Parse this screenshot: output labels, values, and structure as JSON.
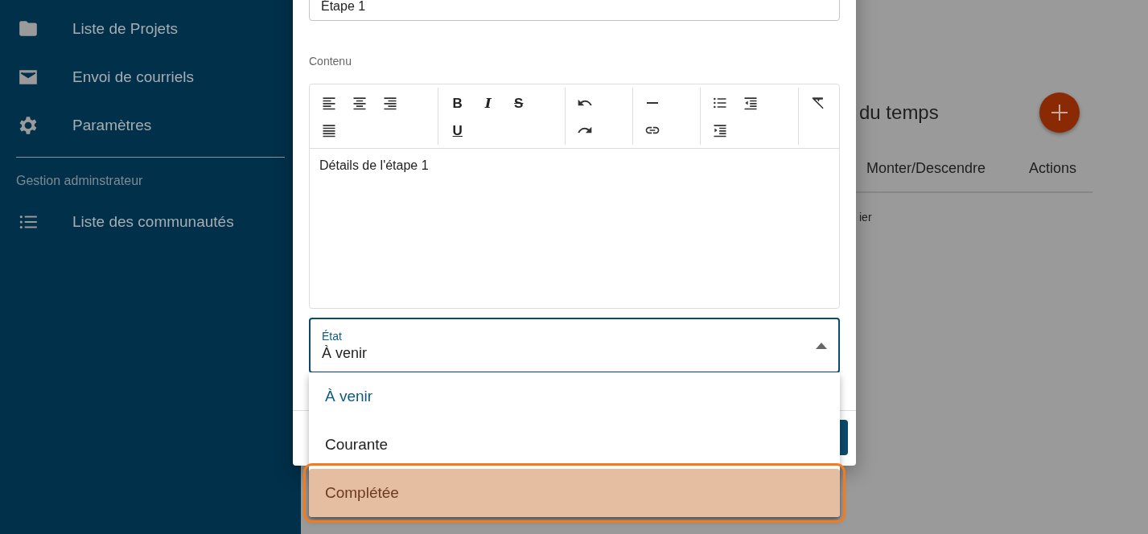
{
  "sidebar": {
    "items": [
      {
        "kind": "folder",
        "label": "Liste de Projets"
      },
      {
        "kind": "mail",
        "label": "Envoi de courriels"
      },
      {
        "kind": "settings",
        "label": "Paramètres"
      }
    ],
    "section_label": "Gestion adminstrateur",
    "admin_items": [
      {
        "kind": "list",
        "label": "Liste des communautés"
      }
    ]
  },
  "background_page": {
    "title": "du temps",
    "columns": [
      "Monter/Descendre",
      "Actions"
    ],
    "cell": "ier"
  },
  "dialog": {
    "name_field": {
      "value": "Étape 1"
    },
    "content_label": "Contenu",
    "editor": {
      "toolbar": [
        [
          {
            "kind": "align-left"
          },
          {
            "kind": "align-center"
          },
          {
            "kind": "align-right"
          },
          {
            "kind": "justify"
          }
        ],
        [
          {
            "kind": "bold",
            "label": "B"
          },
          {
            "kind": "italic",
            "label": "I"
          },
          {
            "kind": "strike",
            "label": "S"
          },
          {
            "kind": "underline",
            "label": "U"
          }
        ],
        [
          {
            "kind": "undo"
          },
          {
            "kind": "redo"
          }
        ],
        [
          {
            "kind": "rule"
          },
          {
            "kind": "link"
          }
        ],
        [
          {
            "kind": "bullets"
          },
          {
            "kind": "outdent"
          },
          {
            "kind": "indent"
          }
        ],
        [
          {
            "kind": "clear"
          }
        ]
      ],
      "text": "Détails de l'étape 1"
    },
    "state_field": {
      "label": "État",
      "value": "À venir",
      "expanded": true
    },
    "options": [
      {
        "label": "À venir",
        "selected": true,
        "highlighted": false
      },
      {
        "label": "Courante",
        "selected": false,
        "highlighted": false
      },
      {
        "label": "Complétée",
        "selected": false,
        "highlighted": true
      }
    ]
  }
}
